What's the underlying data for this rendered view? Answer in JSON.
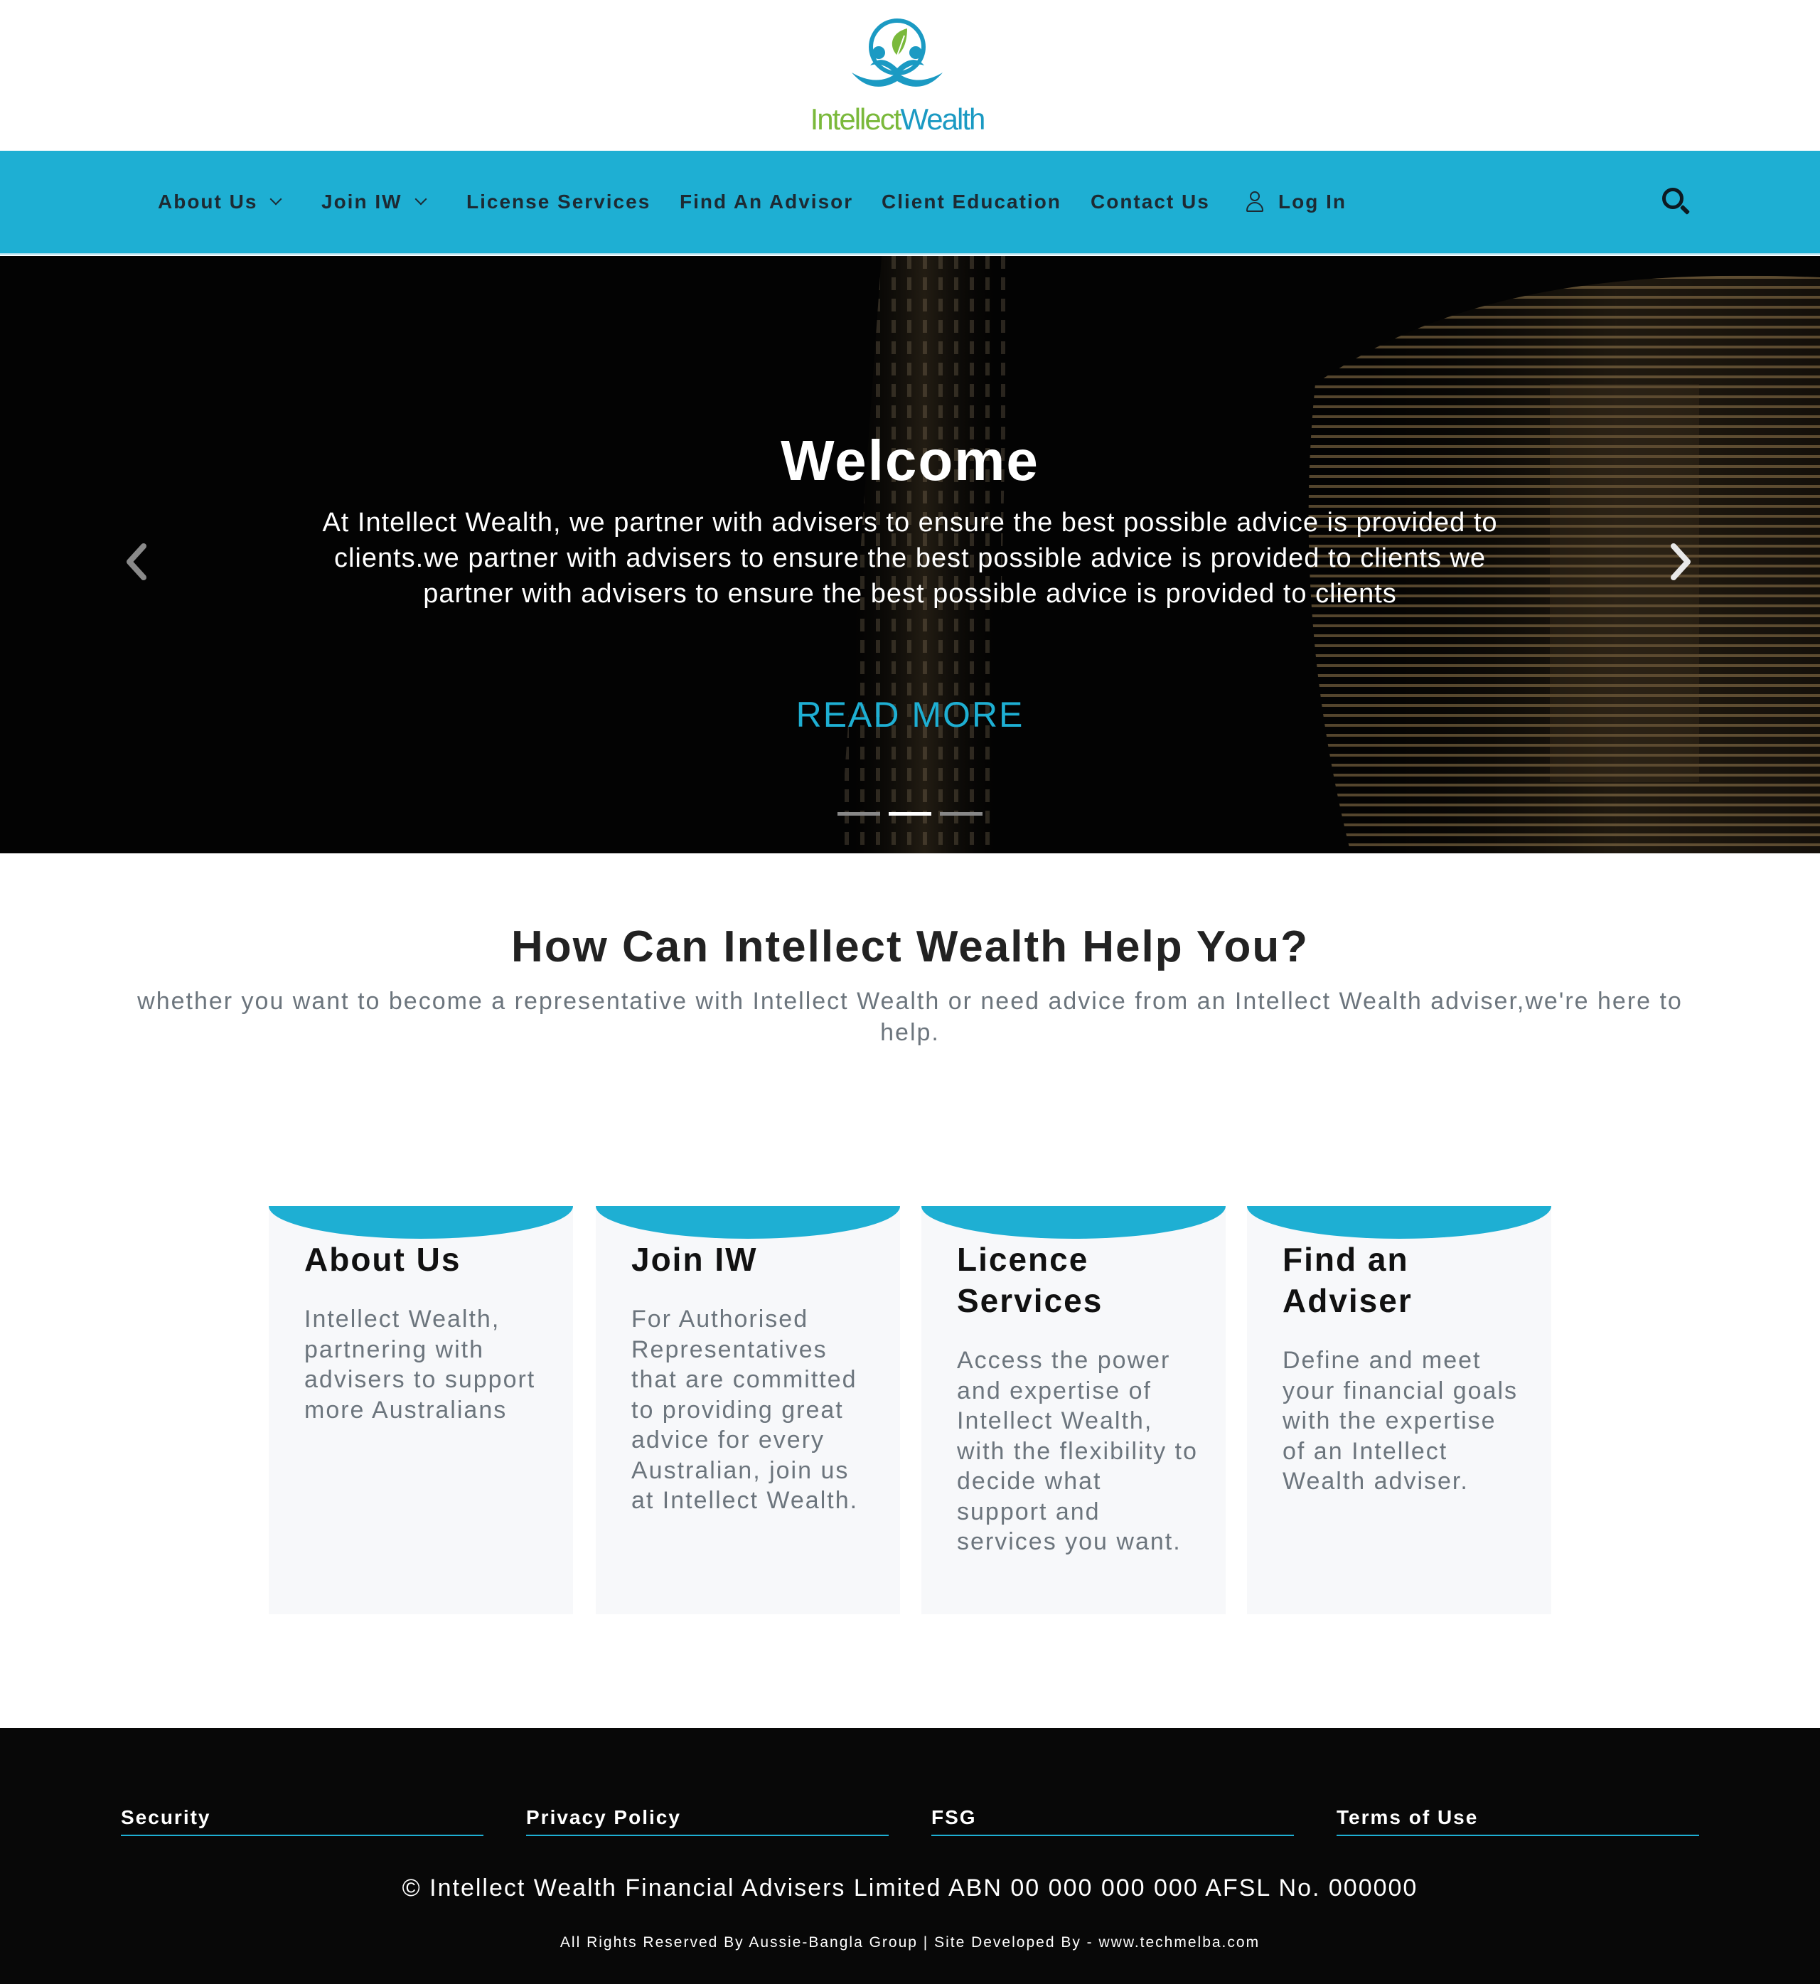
{
  "brand": {
    "logo_part1": "Intellect",
    "logo_part2": "Wealth",
    "colors": {
      "primary": "#1eafd3",
      "green": "#7ab93b",
      "logo_blue": "#1b9ac3",
      "footer_bg": "#080808"
    }
  },
  "nav": {
    "items": [
      {
        "label": "About Us",
        "dropdown": true
      },
      {
        "label": "Join IW",
        "dropdown": true
      },
      {
        "label": "License Services"
      },
      {
        "label": "Find An Advisor"
      },
      {
        "label": "Client Education"
      },
      {
        "label": "Contact Us"
      },
      {
        "label": "Log In",
        "icon": "user-icon"
      }
    ],
    "search_icon": "search-icon"
  },
  "hero": {
    "title": "Welcome",
    "text": "At Intellect Wealth, we partner with advisers to ensure the best possible advice is provided to clients.we partner with advisers to ensure the best possible advice is provided to clients we partner with advisers to ensure the best possible advice is provided to clients",
    "cta": "READ MORE",
    "slide_count": 3,
    "active_slide": 2
  },
  "help": {
    "title": "How Can Intellect Wealth Help You?",
    "subtitle": "whether you want to become a representative with Intellect Wealth or need advice from an Intellect Wealth adviser,we're here to help."
  },
  "cards": [
    {
      "title": "About Us",
      "text": "Intellect Wealth, partnering with advisers to support more Australians"
    },
    {
      "title": "Join IW",
      "text": "For Authorised Representatives that are committed to providing great advice for every Australian, join us at Intellect Wealth."
    },
    {
      "title": "Licence Services",
      "text": "Access the power and expertise of Intellect Wealth, with the flexibility to decide what support and services you want."
    },
    {
      "title": "Find an Adviser",
      "text": "Define and meet your financial goals with the expertise of an Intellect Wealth adviser."
    }
  ],
  "footer": {
    "links": [
      "Security",
      "Privacy Policy",
      "FSG",
      "Terms of Use"
    ],
    "copyright": "© Intellect Wealth Financial Advisers Limited ABN 00 000 000 000 AFSL No. 000000",
    "credits": "All Rights Reserved By Aussie-Bangla Group | Site Developed By - www.techmelba.com"
  }
}
